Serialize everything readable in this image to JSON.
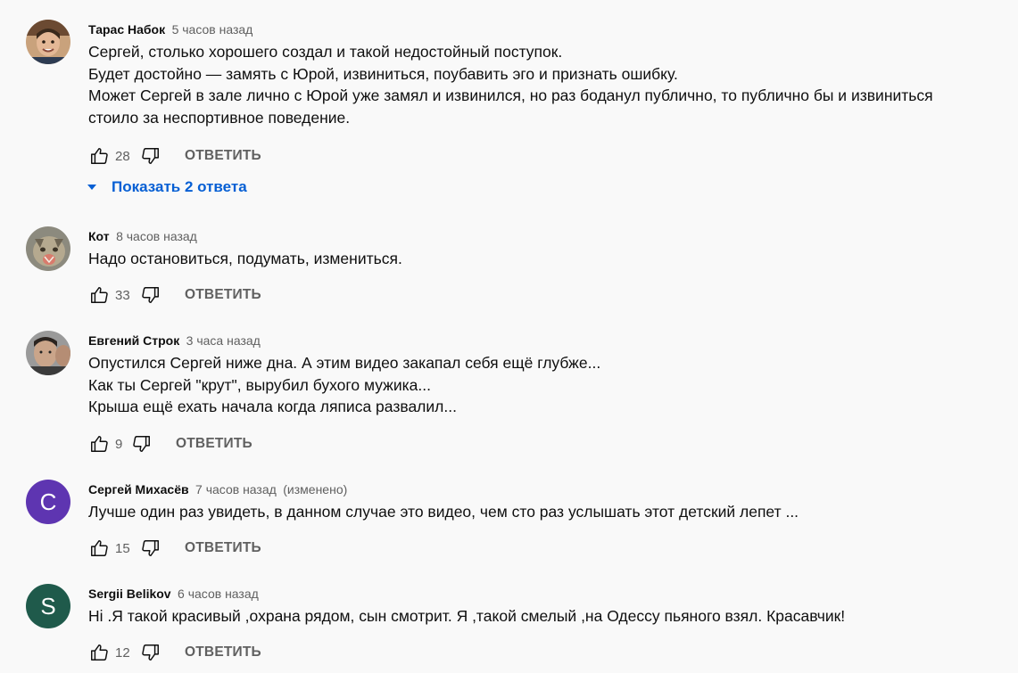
{
  "comments": [
    {
      "author": "Тарас Набок",
      "time": "5 часов назад",
      "edited": "",
      "lines": [
        "Сергей, столько хорошего создал и такой недостойный поступок.",
        "Будет достойно — замять с Юрой, извиниться, поубавить эго и признать ошибку.",
        "Может Сергей в зале лично с Юрой уже замял и извинился, но раз боданул публично, то публично бы и извиниться",
        "стоило за неспортивное поведение."
      ],
      "likes": "28",
      "reply_label": "ОТВЕТИТЬ",
      "show_replies": "Показать 2 ответа"
    },
    {
      "author": "Кот",
      "time": "8 часов назад",
      "edited": "",
      "lines": [
        "Надо остановиться, подумать, измениться."
      ],
      "likes": "33",
      "reply_label": "ОТВЕТИТЬ"
    },
    {
      "author": "Евгений Строк",
      "time": "3 часа назад",
      "edited": "",
      "lines": [
        "Опустился Сергей ниже дна. А этим видео закапал себя ещё глубже...",
        "Как ты Сергей \"крут\", вырубил бухого мужика...",
        "Крыша ещё ехать начала когда ляписа развалил..."
      ],
      "likes": "9",
      "reply_label": "ОТВЕТИТЬ"
    },
    {
      "author": "Сергей Михасёв",
      "time": "7 часов назад",
      "edited": "(изменено)",
      "avatar_letter": "С",
      "avatar_color": "#5e35b1",
      "lines": [
        "Лучше один раз увидеть, в данном случае это видео, чем сто раз услышать этот детский лепет ..."
      ],
      "likes": "15",
      "reply_label": "ОТВЕТИТЬ"
    },
    {
      "author": "Sergii Belikov",
      "time": "6 часов назад",
      "edited": "",
      "avatar_letter": "S",
      "avatar_color": "#1f5a4b",
      "lines": [
        "Ні .Я такой красивый ,охрана рядом, сын смотрит. Я ,такой смелый ,на Одессу пьяного взял. Красавчик!"
      ],
      "likes": "12",
      "reply_label": "ОТВЕТИТЬ"
    }
  ],
  "icons": {
    "like": "thumb-up-icon",
    "dislike": "thumb-down-icon",
    "expand": "caret-down-icon"
  },
  "colors": {
    "background": "#f9f9f9",
    "link": "#065fd4",
    "secondary_text": "#606060"
  }
}
